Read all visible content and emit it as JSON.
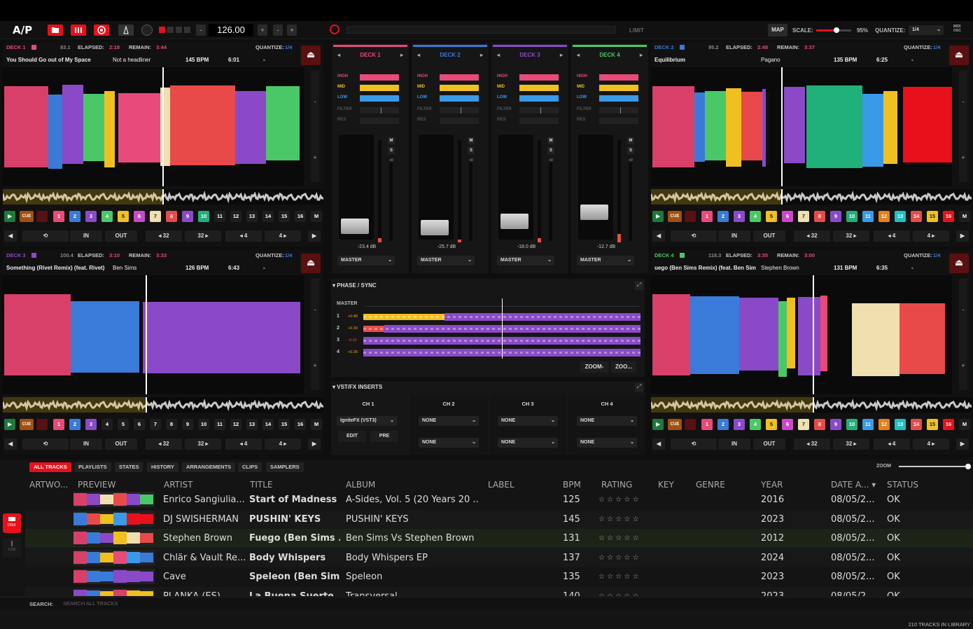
{
  "toolbar": {
    "logo": "A/P",
    "bpm": "126.00",
    "minus": "-",
    "plus": "+",
    "limit": "LIMIT",
    "map": "MAP",
    "scale_label": "SCALE:",
    "scale_value": "95%",
    "scale_level": 0.95,
    "quantize_label": "QUANTIZE:",
    "quantize_value": "1/4",
    "midi": "MIDI",
    "osc": "OSC"
  },
  "decks": [
    {
      "name": "DECK 1",
      "color": "#e84a7a",
      "key": "83.1",
      "elapsed_label": "ELAPSED:",
      "elapsed": "2:18",
      "remain_label": "REMAIN:",
      "remain": "3:44",
      "quantize_label": "QUANTIZE:",
      "quantize": "1/4",
      "title": "You Should Go out of My Space",
      "artist": "Not a headliner",
      "bpm": "145 BPM",
      "length": "6:01",
      "dash": "-"
    },
    {
      "name": "DECK 2",
      "color": "#3a7ad8",
      "key": "95.2",
      "elapsed_label": "ELAPSED:",
      "elapsed": "2:48",
      "remain_label": "REMAIN:",
      "remain": "3:37",
      "quantize_label": "QUANTIZE:",
      "quantize": "1/4",
      "title": "Equilibrium",
      "artist": "Pagano",
      "bpm": "135 BPM",
      "length": "6:25",
      "dash": "-"
    },
    {
      "name": "DECK 3",
      "color": "#8a4ac8",
      "key": "100.4",
      "elapsed_label": "ELAPSED:",
      "elapsed": "3:10",
      "remain_label": "REMAIN:",
      "remain": "3:33",
      "quantize_label": "QUANTIZE:",
      "quantize": "1/4",
      "title": "Something (Rivet Remix) (feat. Rivet)",
      "artist": "Ben Sims",
      "bpm": "126 BPM",
      "length": "6:43",
      "dash": "-"
    },
    {
      "name": "DECK 4",
      "color": "#4ac868",
      "key": "118.3",
      "elapsed_label": "ELAPSED:",
      "elapsed": "3:35",
      "remain_label": "REMAIN:",
      "remain": "3:00",
      "quantize_label": "QUANTIZE:",
      "quantize": "1/4",
      "title": "uego (Ben Sims Remix) (feat. Ben Sims)",
      "artist": "Stephen Brown",
      "bpm": "131 BPM",
      "length": "6:35",
      "dash": "-"
    }
  ],
  "transport": {
    "cue": "CUE",
    "in": "IN",
    "out": "OUT",
    "b32l": "◂ 32",
    "b32r": "32 ▸",
    "b4l": "◂ 4",
    "b4r": "4 ▸",
    "m": "M",
    "hotcues": [
      "1",
      "2",
      "3",
      "4",
      "5",
      "6",
      "7",
      "8",
      "9",
      "10",
      "11",
      "12",
      "13",
      "14",
      "15",
      "16"
    ]
  },
  "mixer": {
    "channels": [
      {
        "name": "DECK 1",
        "color": "#e84a7a",
        "db": "-23.4 dB",
        "out": "MASTER"
      },
      {
        "name": "DECK 2",
        "color": "#3a7ad8",
        "db": "-25.7 dB",
        "out": "MASTER"
      },
      {
        "name": "DECK 3",
        "color": "#8a4ac8",
        "db": "-18.0 dB",
        "out": "MASTER"
      },
      {
        "name": "DECK 4",
        "color": "#4ac868",
        "db": "-12.7 dB",
        "out": "MASTER"
      }
    ],
    "eq": {
      "high": "HIGH",
      "mid": "MID",
      "low": "LOW",
      "filter": "FILTER",
      "res": "RES"
    },
    "m": "M",
    "s": "S",
    "zero": "+0"
  },
  "phase": {
    "title": "PHASE / SYNC",
    "master": "MASTER",
    "rows": [
      {
        "n": "1",
        "v": "+0.48"
      },
      {
        "n": "2",
        "v": "+0.30"
      },
      {
        "n": "3",
        "v": "-0.10"
      },
      {
        "n": "4",
        "v": "+0.26"
      }
    ],
    "zoom_out": "ZOOM-",
    "zoom_in": "ZOO..."
  },
  "fx": {
    "title": "VST/FX INSERTS",
    "channels": [
      {
        "name": "CH 1",
        "slot1": "IgniteFX (VST3)",
        "slot2": ""
      },
      {
        "name": "CH 2",
        "slot1": "NONE",
        "slot2": "NONE"
      },
      {
        "name": "CH 3",
        "slot1": "NONE",
        "slot2": "NONE"
      },
      {
        "name": "CH 4",
        "slot1": "NONE",
        "slot2": "NONE"
      }
    ],
    "edit": "EDIT",
    "pre": "PRE"
  },
  "library": {
    "tabs": [
      "ALL TRACKS",
      "PLAYLISTS",
      "STATES",
      "HISTORY",
      "ARRANGEMENTS",
      "CLIPS",
      "SAMPLERS"
    ],
    "zoom": "ZOOM",
    "columns": {
      "artwork": "ARTWO...",
      "preview": "PREVIEW",
      "artist": "ARTIST",
      "title": "TITLE",
      "album": "ALBUM",
      "label": "LABEL",
      "bpm": "BPM",
      "rating": "RATING",
      "key": "KEY",
      "genre": "GENRE",
      "year": "YEAR",
      "date": "DATE A...",
      "status": "STATUS"
    },
    "rows": [
      {
        "artist": "Enrico Sangiulia...",
        "title": "Start of Madness",
        "album": "A-Sides, Vol. 5 (20 Years 20 ...",
        "bpm": "125",
        "year": "2016",
        "date": "08/05/2...",
        "status": "OK"
      },
      {
        "artist": "DJ SWISHERMAN",
        "title": "PUSHIN' KEYS",
        "album": "PUSHIN' KEYS",
        "bpm": "145",
        "year": "2023",
        "date": "08/05/2...",
        "status": "OK"
      },
      {
        "artist": "Stephen Brown",
        "title": "Fuego (Ben Sims ...",
        "album": "Ben Sims Vs Stephen Brown",
        "bpm": "131",
        "year": "2012",
        "date": "08/05/2...",
        "status": "OK"
      },
      {
        "artist": "Chlär & Vault Re...",
        "title": "Body Whispers",
        "album": "Body Whispers EP",
        "bpm": "137",
        "year": "2024",
        "date": "08/05/2...",
        "status": "OK"
      },
      {
        "artist": "Cave",
        "title": "Speleon (Ben Sim...",
        "album": "Speleon",
        "bpm": "135",
        "year": "2023",
        "date": "08/05/2...",
        "status": "OK"
      },
      {
        "artist": "PLANKA (ES)",
        "title": "La Buena Suerte",
        "album": "Transversal",
        "bpm": "140",
        "year": "2023",
        "date": "08/05/2...",
        "status": "OK"
      }
    ],
    "stars": "☆ ☆ ☆ ☆ ☆",
    "search_label": "SEARCH:",
    "search_placeholder": "SEARCH ALL TRACKS",
    "count": "210 TRACKS IN LIBRARY",
    "disk": "DISK",
    "usb": "USB"
  }
}
